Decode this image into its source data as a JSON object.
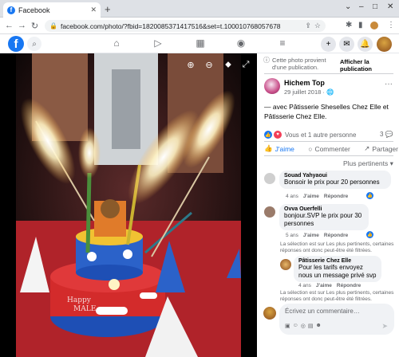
{
  "browser": {
    "tab_title": "Facebook",
    "tab_icon": "facebook-favicon-icon",
    "url": "facebook.com/photo/?fbid=1820085371417516&set=t.100010768057678",
    "window_controls": [
      "–",
      "□",
      "✕"
    ]
  },
  "fb_header": {
    "logo": "f",
    "nav_icons": [
      "home-icon",
      "watch-icon",
      "marketplace-icon",
      "groups-icon",
      "menu-icon"
    ],
    "right_icons": [
      "plus-icon",
      "messenger-icon",
      "notifications-icon",
      "account-avatar"
    ]
  },
  "photo": {
    "controls": [
      "zoom-in-icon",
      "zoom-out-icon",
      "tag-icon",
      "fullscreen-icon"
    ],
    "cake_text": [
      "Happy",
      "MALE"
    ]
  },
  "panel": {
    "notice_text": "Cette photo provient d'une publication.",
    "notice_button": "Afficher la publication",
    "poster_name": "Hichem Top",
    "poster_date": "29 juillet 2018 · ",
    "caption": "— avec Pâtisserie Sheselles Chez Elle et Pâtisserie Chez Elle.",
    "reactions_text": "Vous et 1 autre personne",
    "comment_count": "3",
    "actions": {
      "like": "J'aime",
      "comment": "Commenter",
      "share": "Partager"
    },
    "sort_label": "Plus pertinents"
  },
  "comments": [
    {
      "name": "Souad Yahyaoui",
      "text": "Bonsoir le prix pour 20 personnes",
      "time": "4 ans",
      "like": "J'aime",
      "reply": "Répondre"
    },
    {
      "name": "Ovva Ouerfelli",
      "text": "bonjour.SVP le prix pour 30 personnes",
      "time": "5 ans",
      "like": "J'aime",
      "reply": "Répondre"
    },
    {
      "name": "Pâtisserie Chez Elle",
      "text": "Pour les tarifs envoyez nous un message privé svp",
      "time": "4 ans",
      "like": "J'aime",
      "reply": "Répondre"
    }
  ],
  "filtered_notice": "La sélection est sur Les plus pertinents, certaines réponses ont donc peut-être été filtrées.",
  "composer": {
    "placeholder": "Écrivez un commentaire…"
  }
}
